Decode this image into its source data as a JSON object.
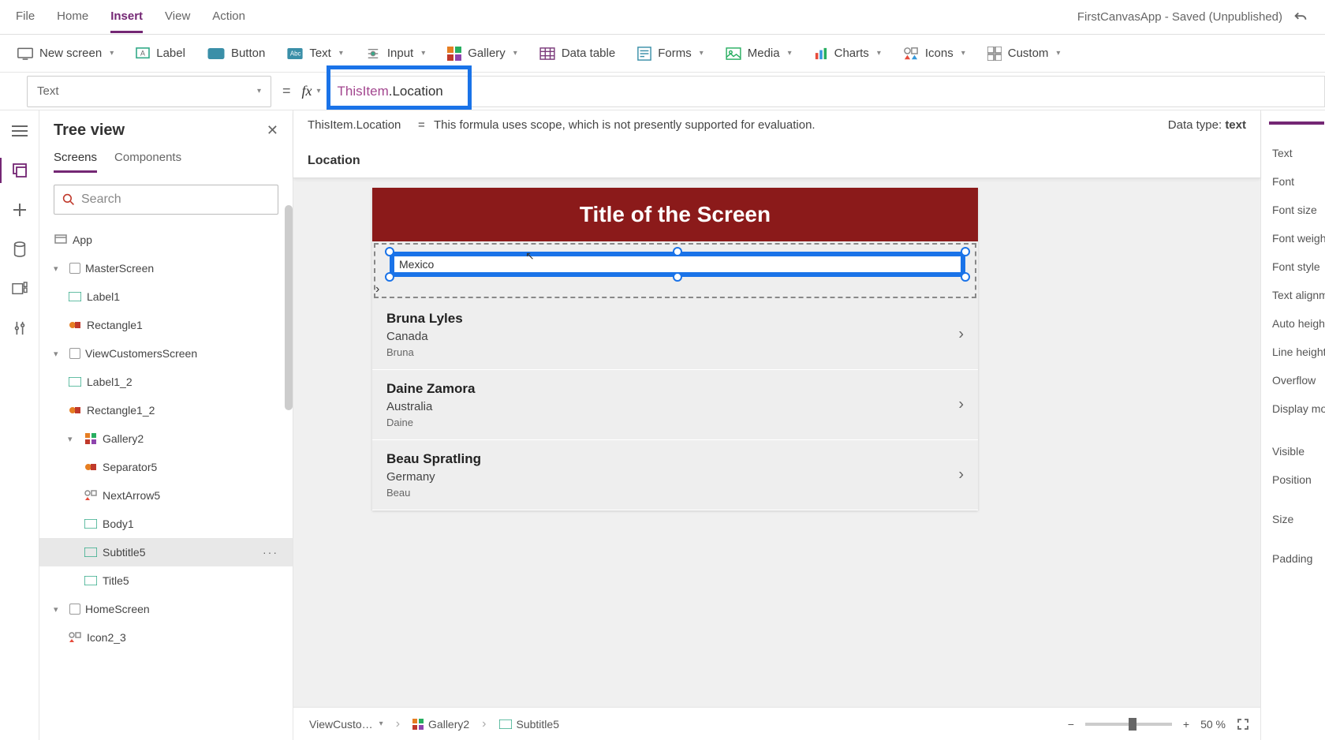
{
  "app_title": "FirstCanvasApp - Saved (Unpublished)",
  "menu": {
    "file": "File",
    "home": "Home",
    "insert": "Insert",
    "view": "View",
    "action": "Action"
  },
  "ribbon": {
    "new_screen": "New screen",
    "label": "Label",
    "button": "Button",
    "text": "Text",
    "input": "Input",
    "gallery": "Gallery",
    "data_table": "Data table",
    "forms": "Forms",
    "media": "Media",
    "charts": "Charts",
    "icons": "Icons",
    "custom": "Custom"
  },
  "formula": {
    "property": "Text",
    "fx": "fx",
    "this": "ThisItem",
    "loc": ".Location",
    "intelli_expr": "ThisItem.Location",
    "intelli_eq": "=",
    "intelli_msg": "This formula uses scope, which is not presently supported for evaluation.",
    "data_type_label": "Data type: ",
    "data_type": "text",
    "suggestion": "Location"
  },
  "tree": {
    "title": "Tree view",
    "tab_screens": "Screens",
    "tab_components": "Components",
    "search_placeholder": "Search",
    "items": {
      "app": "App",
      "master": "MasterScreen",
      "label1": "Label1",
      "rect1": "Rectangle1",
      "view": "ViewCustomersScreen",
      "label1_2": "Label1_2",
      "rect1_2": "Rectangle1_2",
      "gallery2": "Gallery2",
      "sep5": "Separator5",
      "next5": "NextArrow5",
      "body1": "Body1",
      "sub5": "Subtitle5",
      "title5": "Title5",
      "home": "HomeScreen",
      "icon2_3": "Icon2_3"
    }
  },
  "canvas": {
    "title": "Title of the Screen",
    "selected_subtitle": "Mexico",
    "records": [
      {
        "name": "Bruna  Lyles",
        "loc": "Canada",
        "body": "Bruna"
      },
      {
        "name": "Daine  Zamora",
        "loc": "Australia",
        "body": "Daine"
      },
      {
        "name": "Beau  Spratling",
        "loc": "Germany",
        "body": "Beau"
      }
    ]
  },
  "props": {
    "text": "Text",
    "font": "Font",
    "font_size": "Font size",
    "font_weight": "Font weight",
    "font_style": "Font style",
    "text_align": "Text alignment",
    "auto_h": "Auto height",
    "line_h": "Line height",
    "overflow": "Overflow",
    "disp": "Display mode",
    "visible": "Visible",
    "position": "Position",
    "size": "Size",
    "padding": "Padding"
  },
  "breadcrumb": {
    "b1": "ViewCusto…",
    "b2": "Gallery2",
    "b3": "Subtitle5"
  },
  "zoom": {
    "minus": "−",
    "plus": "+",
    "value": "50 %"
  }
}
